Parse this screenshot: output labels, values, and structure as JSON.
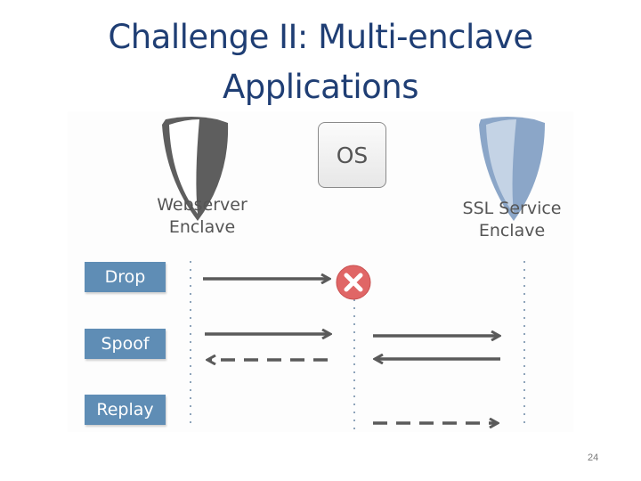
{
  "slide": {
    "title_lines": [
      "Challenge II: Multi-enclave",
      "Applications"
    ],
    "page_number": "24"
  },
  "diagram": {
    "os_label": "OS",
    "enclaves": [
      {
        "name_line1": "Webserver",
        "name_line2": "Enclave",
        "icon": "shield-dark-icon"
      },
      {
        "name_line1": "SSL Service",
        "name_line2": "Enclave",
        "icon": "shield-blue-icon"
      }
    ],
    "attacks": [
      {
        "label": "Drop"
      },
      {
        "label": "Spoof"
      },
      {
        "label": "Replay"
      }
    ],
    "colors": {
      "title": "#1f3e74",
      "attack_box": "#5f8db5",
      "arrow": "#5a5a5a",
      "dotted_line": "#8ea4ba",
      "blocked_icon": "#e06666",
      "shield_dark": "#5e5e5e",
      "shield_blue": "#8ba6c8",
      "shield_blue_light": "#c4d3e5"
    }
  }
}
